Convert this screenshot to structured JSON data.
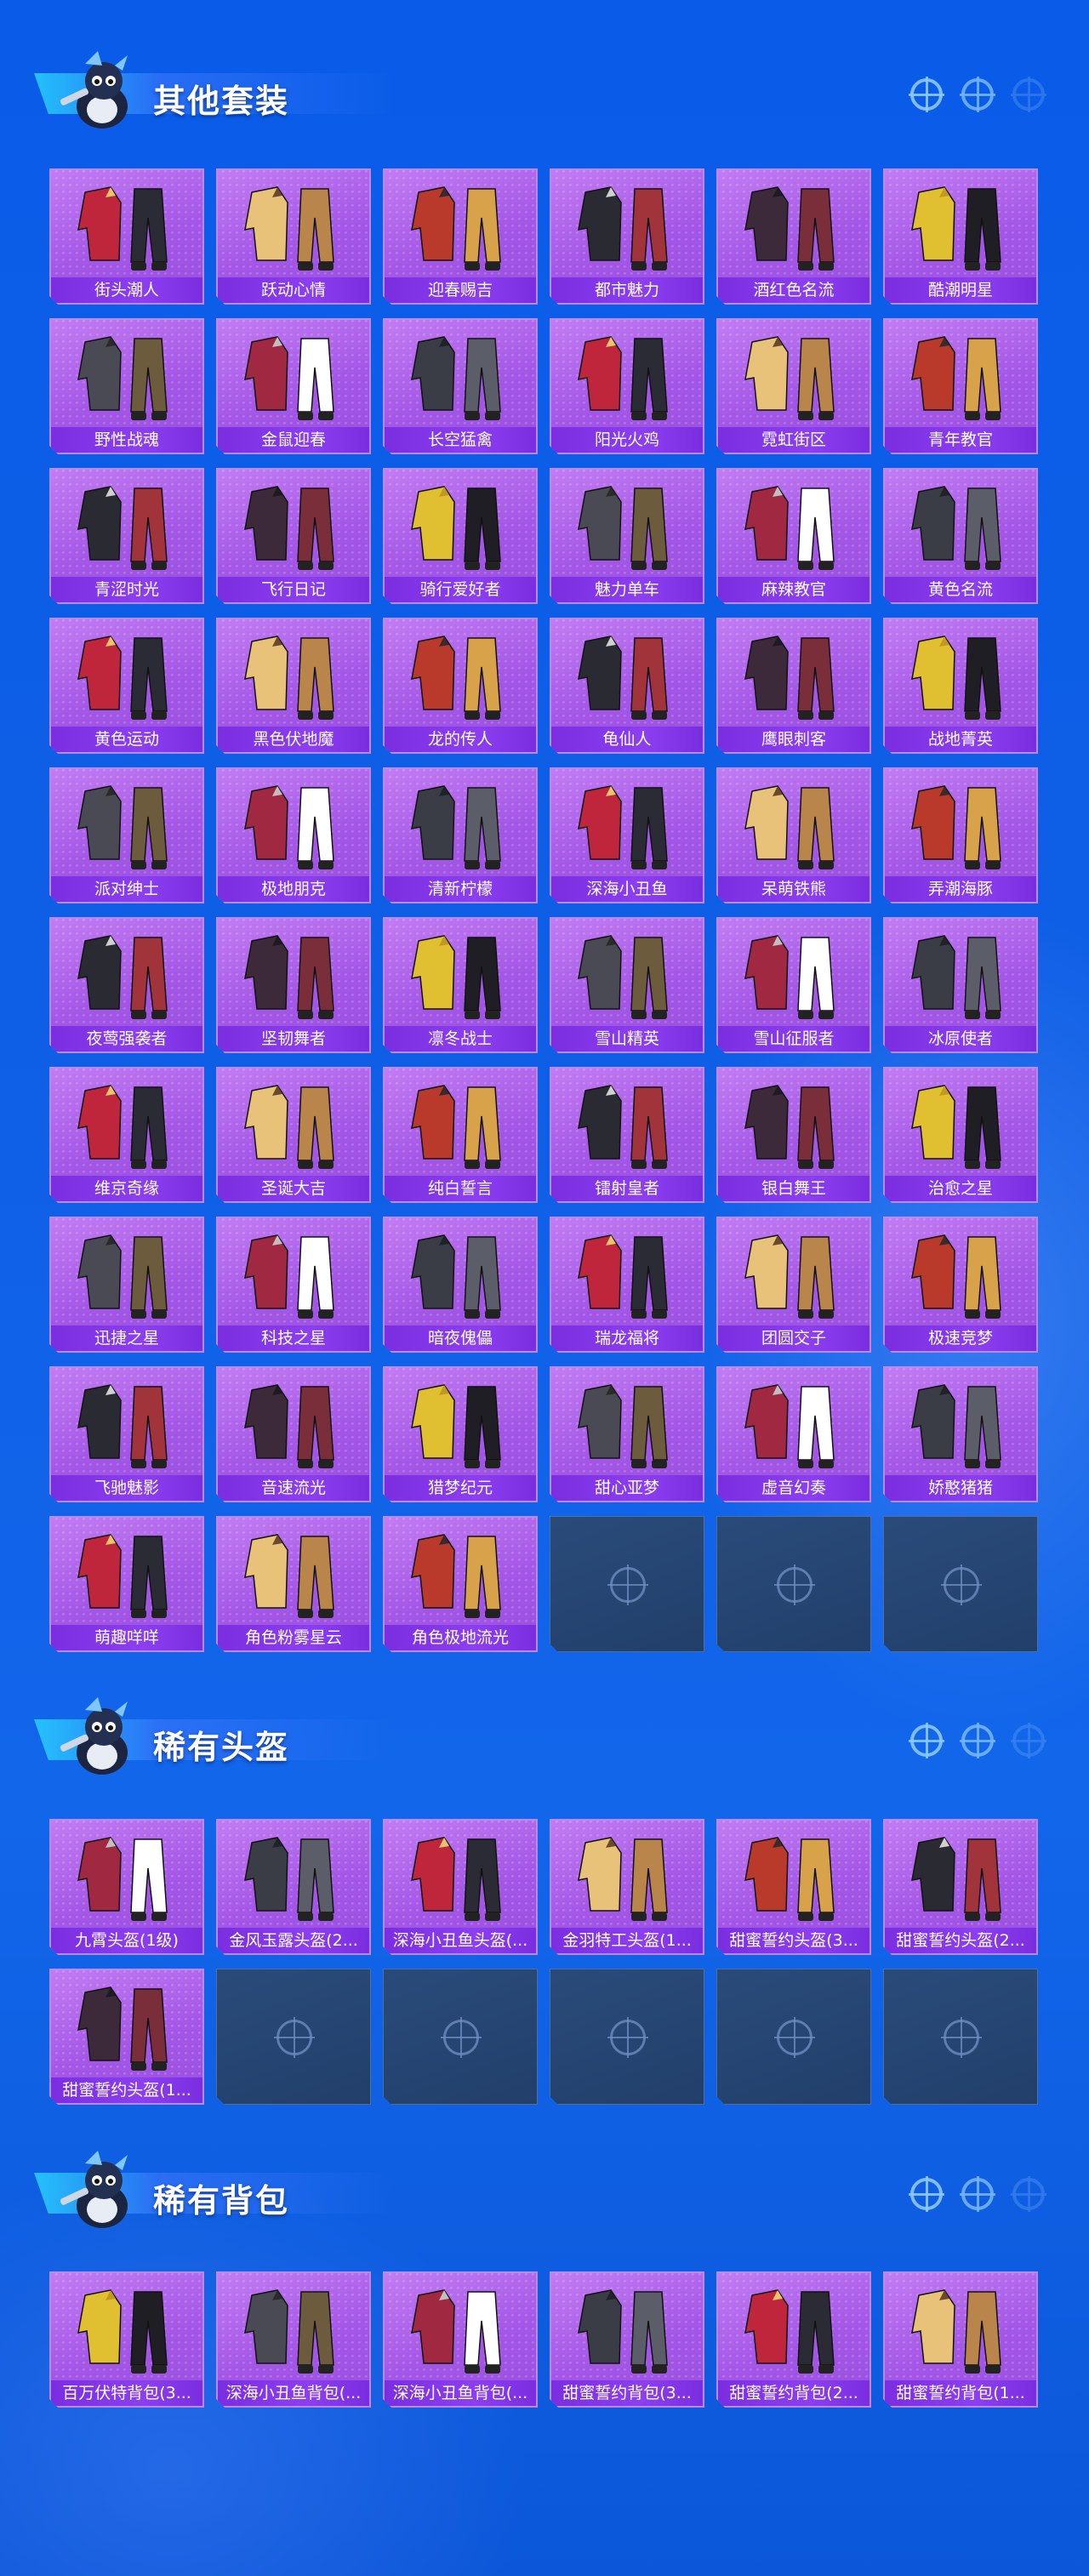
{
  "sections": [
    {
      "title": "其他套装",
      "items": [
        "街头潮人",
        "跃动心情",
        "迎春赐吉",
        "都市魅力",
        "酒红色名流",
        "酷潮明星",
        "野性战魂",
        "金鼠迎春",
        "长空猛禽",
        "阳光火鸡",
        "霓虹街区",
        "青年教官",
        "青涩时光",
        "飞行日记",
        "骑行爱好者",
        "魅力单车",
        "麻辣教官",
        "黄色名流",
        "黄色运动",
        "黑色伏地魔",
        "龙的传人",
        "龟仙人",
        "鹰眼刺客",
        "战地菁英",
        "派对绅士",
        "极地朋克",
        "清新柠檬",
        "深海小丑鱼",
        "呆萌铁熊",
        "弄潮海豚",
        "夜莺强袭者",
        "坚韧舞者",
        "凛冬战士",
        "雪山精英",
        "雪山征服者",
        "冰原使者",
        "维京奇缘",
        "圣诞大吉",
        "纯白誓言",
        "镭射皇者",
        "银白舞王",
        "治愈之星",
        "迅捷之星",
        "科技之星",
        "暗夜傀儡",
        "瑞龙福将",
        "团圆交子",
        "极速竞梦",
        "飞驰魅影",
        "音速流光",
        "猎梦纪元",
        "甜心亚梦",
        "虚音幻奏",
        "娇憨猪猪",
        "萌趣咩咩",
        "角色粉雾星云",
        "角色极地流光"
      ],
      "empty_slots": 3
    },
    {
      "title": "稀有头盔",
      "items": [
        "九霄头盔(1级)",
        "金风玉露头盔(2...",
        "深海小丑鱼头盔(...",
        "金羽特工头盔(1...",
        "甜蜜誓约头盔(3...",
        "甜蜜誓约头盔(2...",
        "甜蜜誓约头盔(1..."
      ],
      "empty_slots": 5
    },
    {
      "title": "稀有背包",
      "items": [
        "百万伏特背包(3...",
        "深海小丑鱼背包(...",
        "深海小丑鱼背包(...",
        "甜蜜誓约背包(3...",
        "甜蜜誓约背包(2...",
        "甜蜜誓约背包(1..."
      ],
      "empty_slots": 0
    }
  ],
  "icons": {
    "section_mascot": "penguin-mascot-icon",
    "section_deco": "crosshair-icon",
    "empty_slot": "crosshair-icon",
    "item_thumb": "outfit-thumbnail-icon"
  },
  "colors": {
    "background": "#0f5fe6",
    "card": "#a457e6",
    "label_bar": "#8b3ff0",
    "empty_slot": "#223f6a"
  }
}
